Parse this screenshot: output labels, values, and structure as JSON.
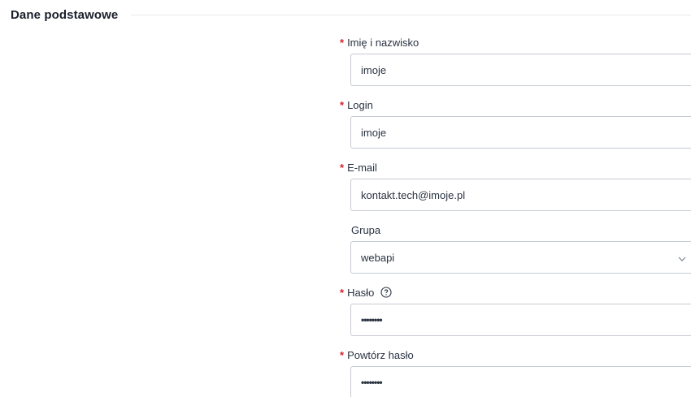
{
  "section": {
    "title": "Dane podstawowe"
  },
  "fields": {
    "name": {
      "label": "Imię i nazwisko",
      "value": "imoje",
      "required": true
    },
    "login": {
      "label": "Login",
      "value": "imoje",
      "required": true
    },
    "email": {
      "label": "E-mail",
      "value": "kontakt.tech@imoje.pl",
      "required": true
    },
    "group": {
      "label": "Grupa",
      "value": "webapi",
      "required": false
    },
    "password": {
      "label": "Hasło",
      "value": "••••••••",
      "required": true
    },
    "password_repeat": {
      "label": "Powtórz hasło",
      "value": "••••••••",
      "required": true
    }
  },
  "required_marker": "*",
  "icons": {
    "help": "help-circle-icon",
    "dropdown": "chevron-down-icon"
  },
  "colors": {
    "required": "#d9202c",
    "border": "#c5cad3",
    "text": "#2a3342"
  }
}
